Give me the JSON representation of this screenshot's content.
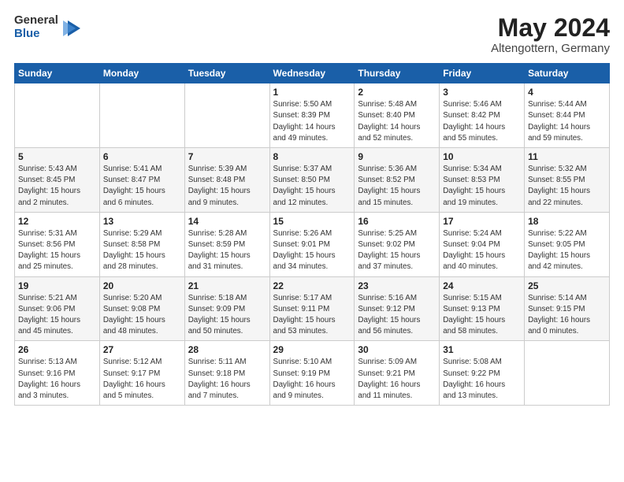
{
  "header": {
    "logo_line1": "General",
    "logo_line2": "Blue",
    "month_year": "May 2024",
    "location": "Altengottern, Germany"
  },
  "days_of_week": [
    "Sunday",
    "Monday",
    "Tuesday",
    "Wednesday",
    "Thursday",
    "Friday",
    "Saturday"
  ],
  "weeks": [
    [
      {
        "day": "",
        "info": ""
      },
      {
        "day": "",
        "info": ""
      },
      {
        "day": "",
        "info": ""
      },
      {
        "day": "1",
        "info": "Sunrise: 5:50 AM\nSunset: 8:39 PM\nDaylight: 14 hours\nand 49 minutes."
      },
      {
        "day": "2",
        "info": "Sunrise: 5:48 AM\nSunset: 8:40 PM\nDaylight: 14 hours\nand 52 minutes."
      },
      {
        "day": "3",
        "info": "Sunrise: 5:46 AM\nSunset: 8:42 PM\nDaylight: 14 hours\nand 55 minutes."
      },
      {
        "day": "4",
        "info": "Sunrise: 5:44 AM\nSunset: 8:44 PM\nDaylight: 14 hours\nand 59 minutes."
      }
    ],
    [
      {
        "day": "5",
        "info": "Sunrise: 5:43 AM\nSunset: 8:45 PM\nDaylight: 15 hours\nand 2 minutes."
      },
      {
        "day": "6",
        "info": "Sunrise: 5:41 AM\nSunset: 8:47 PM\nDaylight: 15 hours\nand 6 minutes."
      },
      {
        "day": "7",
        "info": "Sunrise: 5:39 AM\nSunset: 8:48 PM\nDaylight: 15 hours\nand 9 minutes."
      },
      {
        "day": "8",
        "info": "Sunrise: 5:37 AM\nSunset: 8:50 PM\nDaylight: 15 hours\nand 12 minutes."
      },
      {
        "day": "9",
        "info": "Sunrise: 5:36 AM\nSunset: 8:52 PM\nDaylight: 15 hours\nand 15 minutes."
      },
      {
        "day": "10",
        "info": "Sunrise: 5:34 AM\nSunset: 8:53 PM\nDaylight: 15 hours\nand 19 minutes."
      },
      {
        "day": "11",
        "info": "Sunrise: 5:32 AM\nSunset: 8:55 PM\nDaylight: 15 hours\nand 22 minutes."
      }
    ],
    [
      {
        "day": "12",
        "info": "Sunrise: 5:31 AM\nSunset: 8:56 PM\nDaylight: 15 hours\nand 25 minutes."
      },
      {
        "day": "13",
        "info": "Sunrise: 5:29 AM\nSunset: 8:58 PM\nDaylight: 15 hours\nand 28 minutes."
      },
      {
        "day": "14",
        "info": "Sunrise: 5:28 AM\nSunset: 8:59 PM\nDaylight: 15 hours\nand 31 minutes."
      },
      {
        "day": "15",
        "info": "Sunrise: 5:26 AM\nSunset: 9:01 PM\nDaylight: 15 hours\nand 34 minutes."
      },
      {
        "day": "16",
        "info": "Sunrise: 5:25 AM\nSunset: 9:02 PM\nDaylight: 15 hours\nand 37 minutes."
      },
      {
        "day": "17",
        "info": "Sunrise: 5:24 AM\nSunset: 9:04 PM\nDaylight: 15 hours\nand 40 minutes."
      },
      {
        "day": "18",
        "info": "Sunrise: 5:22 AM\nSunset: 9:05 PM\nDaylight: 15 hours\nand 42 minutes."
      }
    ],
    [
      {
        "day": "19",
        "info": "Sunrise: 5:21 AM\nSunset: 9:06 PM\nDaylight: 15 hours\nand 45 minutes."
      },
      {
        "day": "20",
        "info": "Sunrise: 5:20 AM\nSunset: 9:08 PM\nDaylight: 15 hours\nand 48 minutes."
      },
      {
        "day": "21",
        "info": "Sunrise: 5:18 AM\nSunset: 9:09 PM\nDaylight: 15 hours\nand 50 minutes."
      },
      {
        "day": "22",
        "info": "Sunrise: 5:17 AM\nSunset: 9:11 PM\nDaylight: 15 hours\nand 53 minutes."
      },
      {
        "day": "23",
        "info": "Sunrise: 5:16 AM\nSunset: 9:12 PM\nDaylight: 15 hours\nand 56 minutes."
      },
      {
        "day": "24",
        "info": "Sunrise: 5:15 AM\nSunset: 9:13 PM\nDaylight: 15 hours\nand 58 minutes."
      },
      {
        "day": "25",
        "info": "Sunrise: 5:14 AM\nSunset: 9:15 PM\nDaylight: 16 hours\nand 0 minutes."
      }
    ],
    [
      {
        "day": "26",
        "info": "Sunrise: 5:13 AM\nSunset: 9:16 PM\nDaylight: 16 hours\nand 3 minutes."
      },
      {
        "day": "27",
        "info": "Sunrise: 5:12 AM\nSunset: 9:17 PM\nDaylight: 16 hours\nand 5 minutes."
      },
      {
        "day": "28",
        "info": "Sunrise: 5:11 AM\nSunset: 9:18 PM\nDaylight: 16 hours\nand 7 minutes."
      },
      {
        "day": "29",
        "info": "Sunrise: 5:10 AM\nSunset: 9:19 PM\nDaylight: 16 hours\nand 9 minutes."
      },
      {
        "day": "30",
        "info": "Sunrise: 5:09 AM\nSunset: 9:21 PM\nDaylight: 16 hours\nand 11 minutes."
      },
      {
        "day": "31",
        "info": "Sunrise: 5:08 AM\nSunset: 9:22 PM\nDaylight: 16 hours\nand 13 minutes."
      },
      {
        "day": "",
        "info": ""
      }
    ]
  ]
}
